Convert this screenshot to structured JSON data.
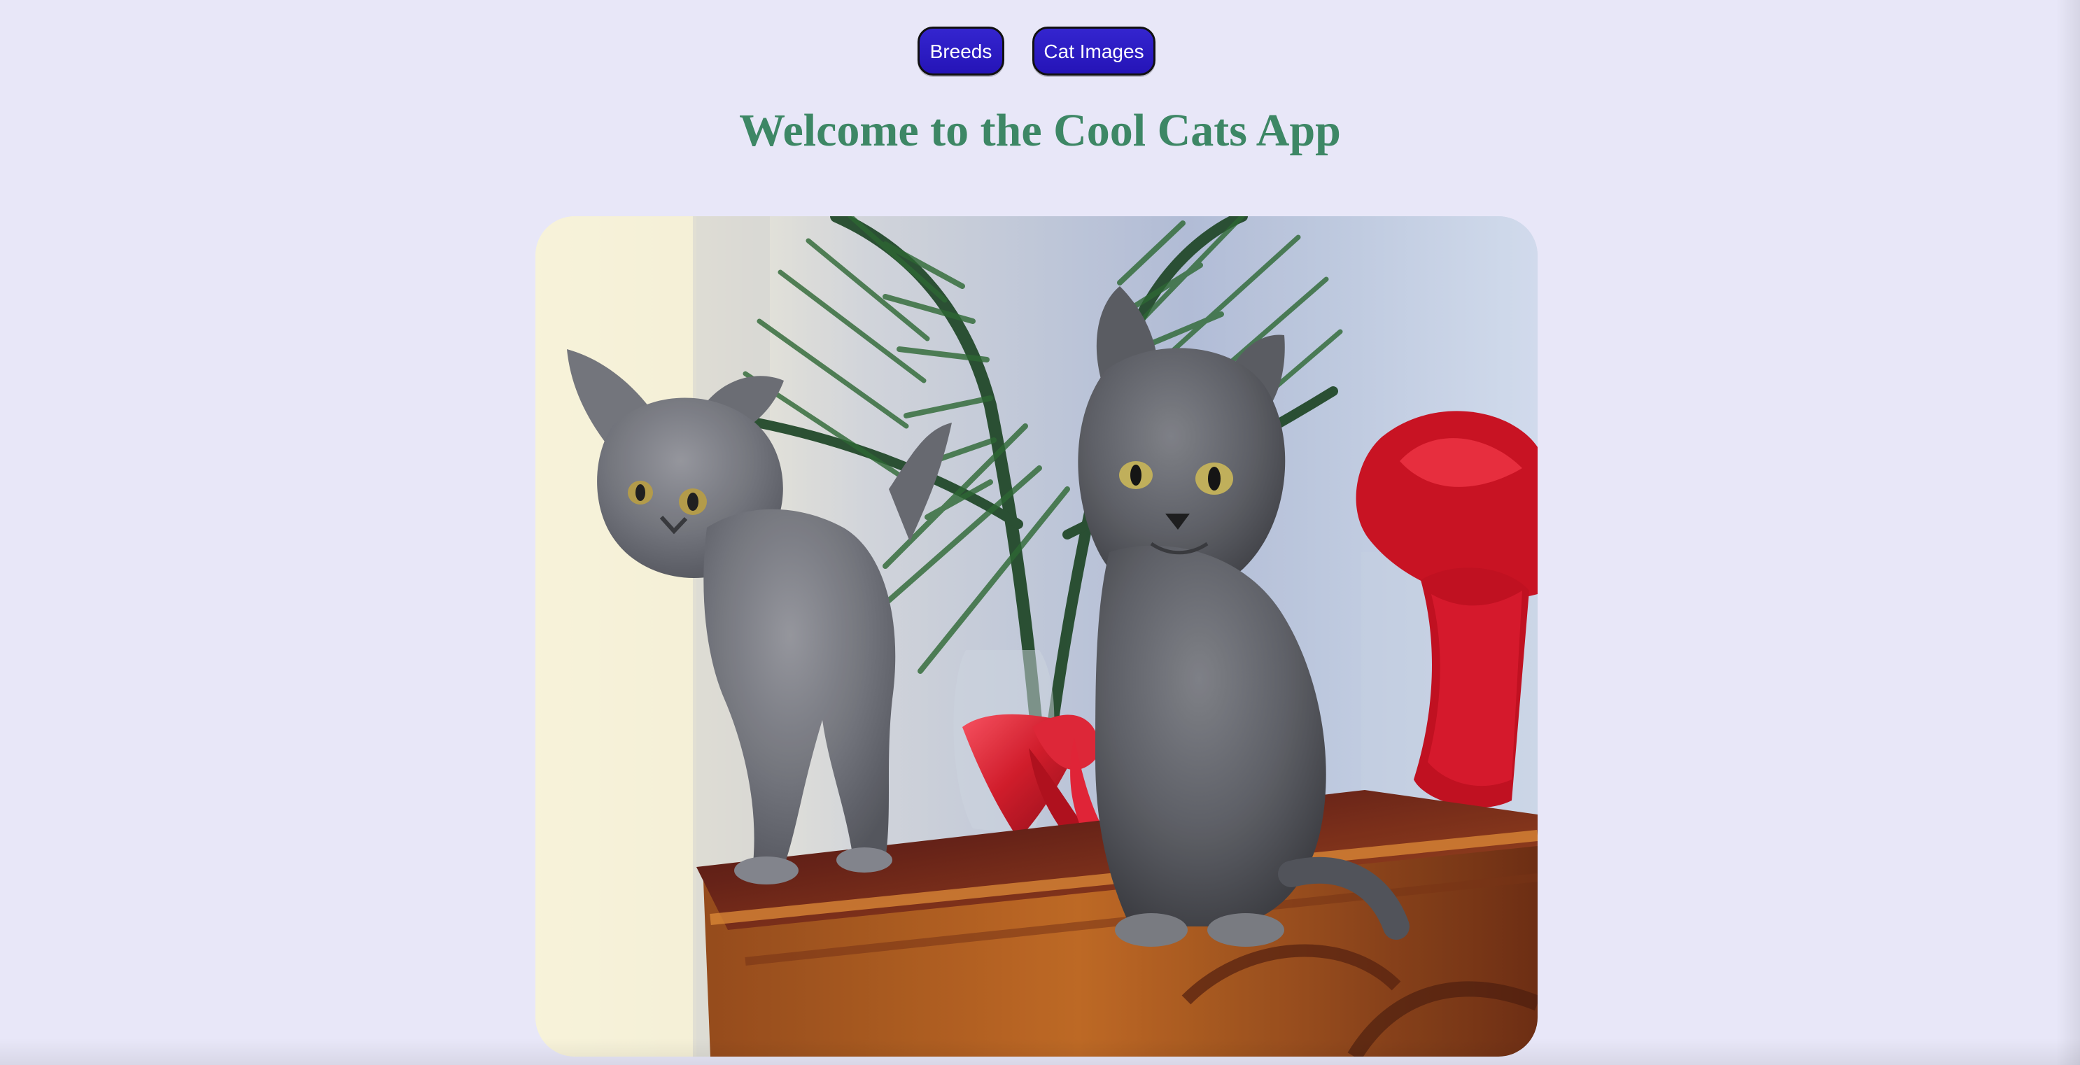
{
  "navigation": {
    "breeds_label": "Breeds",
    "cat_images_label": "Cat Images"
  },
  "page": {
    "title": "Welcome to the Cool Cats App"
  },
  "colors": {
    "background": "#e8e7f8",
    "button": "#2d1dc2",
    "title": "#3d8765"
  },
  "image": {
    "subject": "two gray cats on a wooden table beside pine branches and red flowers"
  }
}
